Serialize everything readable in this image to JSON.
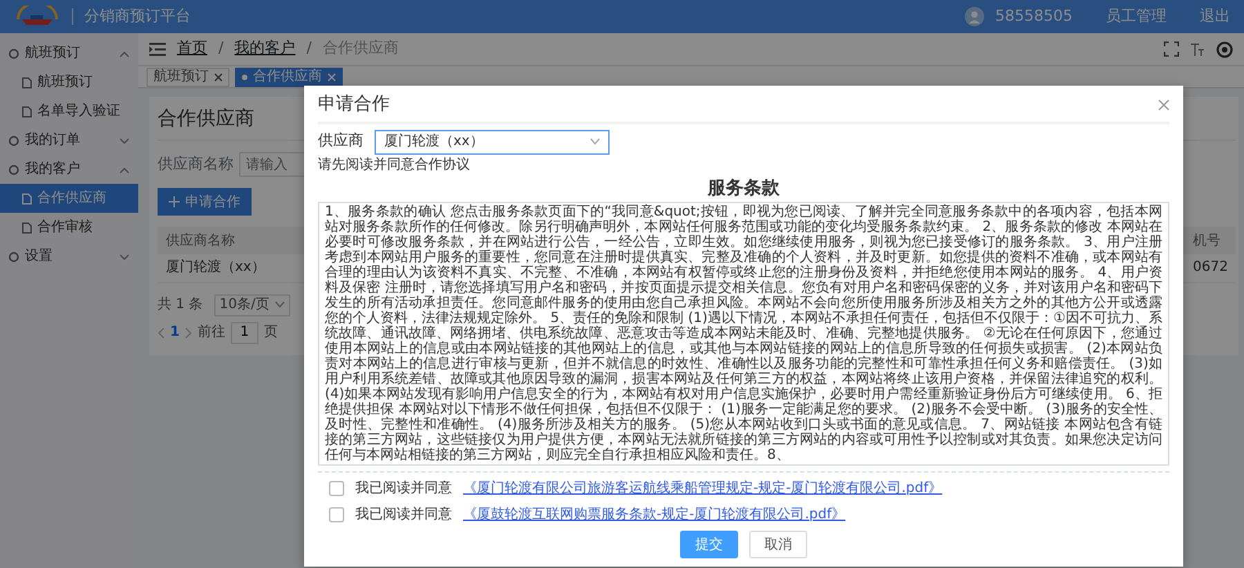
{
  "header": {
    "title": "分销商预订平台",
    "user": "58558505",
    "links": [
      "员工管理",
      "退出"
    ]
  },
  "sidebar": {
    "groups": [
      {
        "label": "航班预订",
        "expanded": true,
        "children": [
          {
            "label": "航班预订",
            "selected": false
          },
          {
            "label": "名单导入验证",
            "selected": false
          }
        ]
      },
      {
        "label": "我的订单",
        "expanded": false
      },
      {
        "label": "我的客户",
        "expanded": true,
        "children": [
          {
            "label": "合作供应商",
            "selected": true
          },
          {
            "label": "合作审核",
            "selected": false
          }
        ]
      },
      {
        "label": "设置",
        "expanded": false
      }
    ]
  },
  "breadcrumb": {
    "items": [
      "首页",
      "我的客户",
      "合作供应商"
    ],
    "separator": "/"
  },
  "tags": [
    {
      "label": "航班预订",
      "selected": false
    },
    {
      "label": "合作供应商",
      "selected": true
    }
  ],
  "page": {
    "title": "合作供应商",
    "search": {
      "label": "供应商名称",
      "placeholder": "请输入"
    },
    "apply_button": "申请合作",
    "table": {
      "columns": [
        "供应商名称",
        "机号"
      ],
      "rows": [
        [
          "厦门轮渡（xx）",
          "0672"
        ]
      ]
    },
    "pagination": {
      "total": "共 1 条",
      "page_size": "10条/页",
      "pages": [
        {
          "label": "1",
          "selected": true
        }
      ],
      "goto_label": "前往",
      "goto_value": "1",
      "goto_suffix": "页"
    }
  },
  "dialog": {
    "title": "申请合作",
    "supplier": {
      "label": "供应商",
      "value": "厦门轮渡（xx）"
    },
    "hint": "请先阅读并同意合作协议",
    "terms_title": "服务条款",
    "terms": "1、服务条款的确认 您点击服务条款页面下的“我同意&quot;按钮，即视为您已阅读、了解并完全同意服务条款中的各项内容，包括本网站对服务条款所作的任何修改。除另行明确声明外，本网站任何服务范围或功能的变化均受服务条款约束。 2、服务条款的修改 本网站在必要时可修改服务条款，并在网站进行公告，一经公告，立即生效。如您继续使用服务，则视为您已接受修订的服务条款。 3、用户注册考虑到本网站用户服务的重要性，您同意在注册时提供真实、完整及准确的个人资料，并及时更新。如您提供的资料不准确，或本网站有合理的理由认为该资料不真实、不完整、不准确，本网站有权暂停或终止您的注册身份及资料，并拒绝您使用本网站的服务。 4、用户资料及保密 注册时，请您选择填写用户名和密码，并按页面提示提交相关信息。您负有对用户名和密码保密的义务，并对该用户名和密码下发生的所有活动承担责任。您同意邮件服务的使用由您自己承担风险。本网站不会向您所使用服务所涉及相关方之外的其他方公开或透露您的个人资料，法律法规规定除外。 5、责任的免除和限制 (1)遇以下情况，本网站不承担任何责任，包括但不仅限于：①因不可抗力、系统故障、通讯故障、网络拥堵、供电系统故障、恶意攻击等造成本网站未能及时、准确、完整地提供服务。 ②无论在任何原因下，您通过使用本网站上的信息或由本网站链接的其他网站上的信息，或其他与本网站链接的网站上的信息所导致的任何损失或损害。 (2)本网站负责对本网站上的信息进行审核与更新，但并不就信息的时效性、准确性以及服务功能的完整性和可靠性承担任何义务和赔偿责任。 (3)如用户利用系统差错、故障或其他原因导致的漏洞，损害本网站及任何第三方的权益，本网站将终止该用户资格，并保留法律追究的权利。 (4)如果本网站发现有影响用户信息安全的行为，本网站有权对用户信息实施保护，必要时用户需经重新验证身份后方可继续使用。 6、拒绝提供担保 本网站对以下情形不做任何担保，包括但不仅限于： (1)服务一定能满足您的要求。 (2)服务不会受中断。 (3)服务的安全性、及时性、完整性和准确性。 (4)服务所涉及相关方的服务。 (5)您从本网站收到口头或书面的意见或信息。 7、网站链接 本网站包含有链接的第三方网站，这些链接仅为用户提供方便，本网站无法就所链接的第三方网站的内容或可用性予以控制或对其负责。如果您决定访问任何与本网站相链接的第三方网站，则应完全自行承担相应风险和责任。8、",
    "agreements": [
      {
        "label": "我已阅读并同意",
        "link": "《厦门轮渡有限公司旅游客运航线乘船管理规定-规定-厦门轮渡有限公司.pdf》",
        "checked": false
      },
      {
        "label": "我已阅读并同意",
        "link": "《厦鼓轮渡互联网购票服务条款-规定-厦门轮渡有限公司.pdf》",
        "checked": false
      }
    ],
    "buttons": [
      {
        "label": "提交",
        "kind": "primary"
      },
      {
        "label": "取消",
        "kind": "default"
      }
    ]
  }
}
